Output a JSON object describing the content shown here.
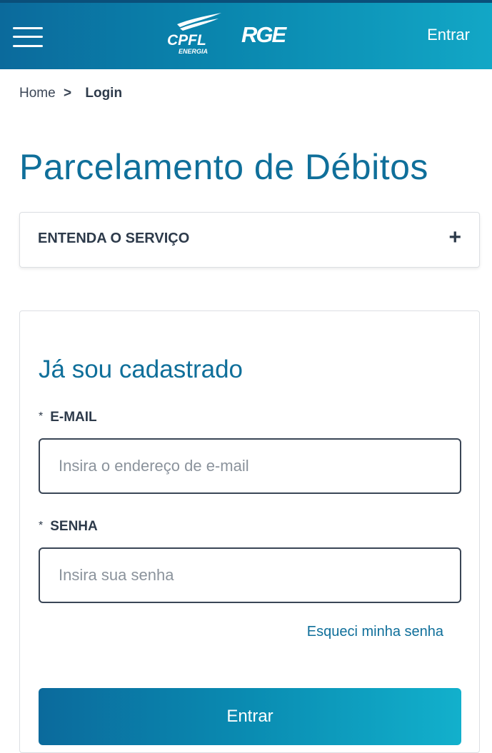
{
  "header": {
    "logo_cpfl_text": "CPFL",
    "logo_cpfl_subtext": "ENERGIA",
    "logo_rge_text": "RGE",
    "login_label": "Entrar",
    "colors": {
      "gradient_start": "#0b6a9c",
      "gradient_end": "#12a7c6"
    }
  },
  "breadcrumb": {
    "home": "Home",
    "separator": ">",
    "current": "Login"
  },
  "page_title": "Parcelamento de Débitos",
  "accordion": {
    "label": "ENTENDA O SERVIÇO",
    "icon": "plus-icon",
    "icon_glyph": "+"
  },
  "login_form": {
    "title": "Já sou cadastrado",
    "email": {
      "required_mark": "*",
      "label": "E-MAIL",
      "value": "",
      "placeholder": "Insira o endereço de e-mail"
    },
    "password": {
      "required_mark": "*",
      "label": "SENHA",
      "value": "",
      "placeholder": "Insira sua senha"
    },
    "forgot_link": "Esqueci minha senha",
    "submit_label": "Entrar"
  }
}
